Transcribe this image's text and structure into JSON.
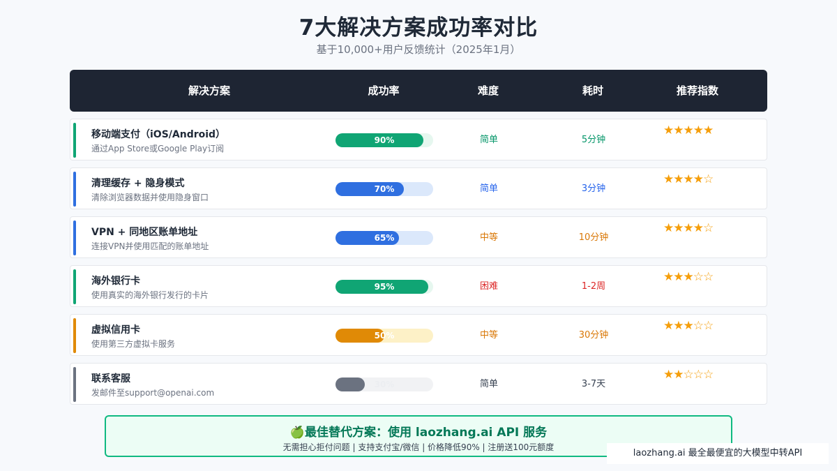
{
  "title": "7大解决方案成功率对比",
  "subtitle": "基于10,000+用户反馈统计（2025年1月）",
  "header": {
    "solution": "解决方案",
    "success_rate": "成功率",
    "difficulty": "难度",
    "time": "耗时",
    "recommend": "推荐指数"
  },
  "chart_data": {
    "type": "table",
    "columns": [
      "解决方案",
      "成功率",
      "难度",
      "耗时",
      "推荐指数"
    ],
    "rows": [
      {
        "name": "移动端支付（iOS/Android）",
        "desc": "通过App Store或Google Play订阅",
        "success": 90,
        "success_label": "90%",
        "difficulty": "简单",
        "time": "5分钟",
        "stars": 5,
        "accent": "#10a574",
        "bar": "#10a574",
        "track": "#e6f7ef",
        "text_color": "#059669",
        "label_color": "#ffffff"
      },
      {
        "name": "清理缓存 + 隐身模式",
        "desc": "清除浏览器数据并使用隐身窗口",
        "success": 70,
        "success_label": "70%",
        "difficulty": "简单",
        "time": "3分钟",
        "stars": 4,
        "accent": "#2f6fe0",
        "bar": "#2f6fe0",
        "track": "#dbe8fb",
        "text_color": "#2563eb",
        "label_color": "#ffffff"
      },
      {
        "name": "VPN + 同地区账单地址",
        "desc": "连接VPN并使用匹配的账单地址",
        "success": 65,
        "success_label": "65%",
        "difficulty": "中等",
        "time": "10分钟",
        "stars": 4,
        "accent": "#2f6fe0",
        "bar": "#2f6fe0",
        "track": "#dbe8fb",
        "text_color": "#d97706",
        "label_color": "#ffffff"
      },
      {
        "name": "海外银行卡",
        "desc": "使用真实的海外银行发行的卡片",
        "success": 95,
        "success_label": "95%",
        "difficulty": "困难",
        "time": "1-2周",
        "stars": 3,
        "accent": "#10a574",
        "bar": "#10a574",
        "track": "#e6f7ef",
        "text_color": "#dc2626",
        "label_color": "#ffffff"
      },
      {
        "name": "虚拟信用卡",
        "desc": "使用第三方虚拟卡服务",
        "success": 50,
        "success_label": "50%",
        "difficulty": "中等",
        "time": "30分钟",
        "stars": 3,
        "accent": "#e08a06",
        "bar": "#e08a06",
        "track": "#fdf1c7",
        "text_color": "#d97706",
        "label_color": "#ffffff"
      },
      {
        "name": "联系客服",
        "desc": "发邮件至support@openai.com",
        "success": 30,
        "success_label": "30%",
        "difficulty": "简单",
        "time": "3-7天",
        "stars": 2,
        "accent": "#6b7280",
        "bar": "#6b7280",
        "track": "#f1f2f4",
        "text_color": "#374151",
        "label_color": "#eceef1"
      }
    ]
  },
  "banner": {
    "title": "🍏最佳替代方案：使用 laozhang.ai API 服务",
    "subtitle": "无需担心拒付问题 | 支持支付宝/微信 | 价格降低90% | 注册送100元额度"
  },
  "footer_tag": "laozhang.ai 最全最便宜的大模型中转API"
}
